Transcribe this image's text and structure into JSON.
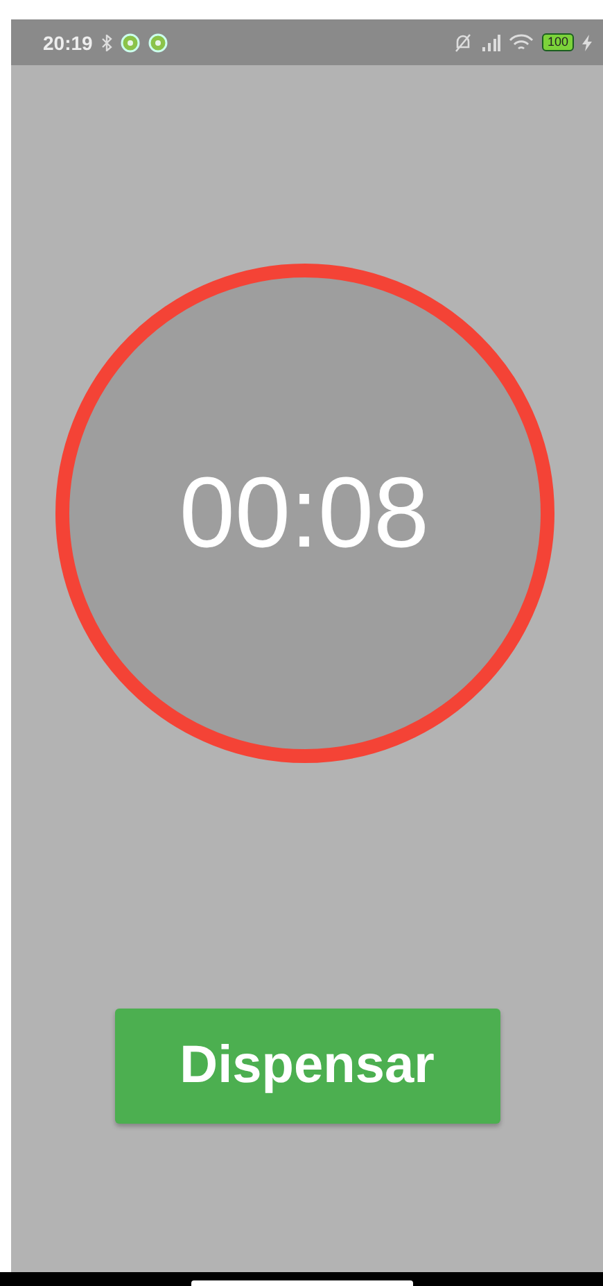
{
  "status_bar": {
    "time": "20:19",
    "battery": "100"
  },
  "timer": {
    "display": "00:08"
  },
  "button": {
    "label": "Dispensar"
  }
}
